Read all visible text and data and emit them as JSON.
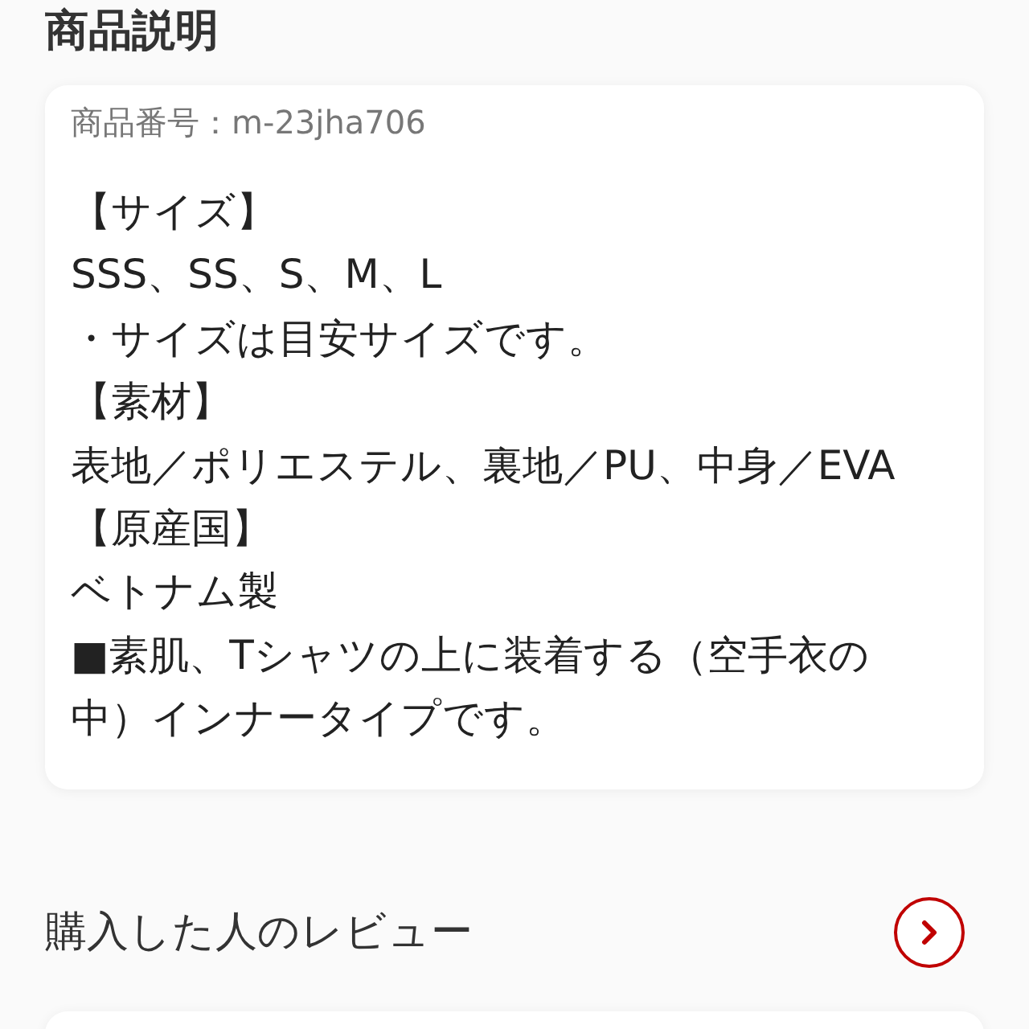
{
  "description_section": {
    "title": "商品説明",
    "product_number": "商品番号：m-23jha706",
    "lines": [
      "【サイズ】",
      "SSS、SS、S、M、L",
      "・サイズは目安サイズです。",
      "【素材】",
      "表地／ポリエステル、裏地／PU、中身／EVA",
      "【原産国】",
      "ベトナム製",
      "■素肌、Tシャツの上に装着する（空手衣の中）インナータイプです。"
    ]
  },
  "reviews_section": {
    "title": "購入した人のレビュー"
  }
}
